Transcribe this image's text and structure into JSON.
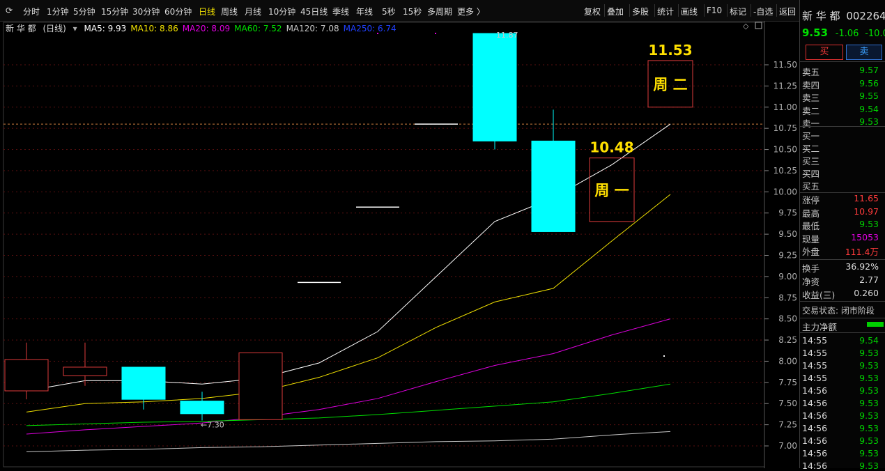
{
  "toolbar": {
    "periods": [
      "分时",
      "1分钟",
      "5分钟",
      "15分钟",
      "30分钟",
      "60分钟",
      "日线",
      "周线",
      "月线",
      "10分钟",
      "45日线",
      "季线",
      "年线",
      "5秒",
      "15秒",
      "多周期",
      "更多 〉"
    ],
    "active_period": "日线",
    "right_buttons": [
      "复权",
      "叠加",
      "多股",
      "统计",
      "画线",
      "F10",
      "标记",
      "-自选",
      "返回"
    ]
  },
  "legend": {
    "name": "新 华 都",
    "period": "(日线)",
    "ma": [
      {
        "label": "MA5: 9.93",
        "color": "#ffffff"
      },
      {
        "label": "MA10: 8.86",
        "color": "#f0e000"
      },
      {
        "label": "MA20: 8.09",
        "color": "#e000e0"
      },
      {
        "label": "MA60: 7.52",
        "color": "#00e000"
      },
      {
        "label": "MA120: 7.08",
        "color": "#c8c8c8"
      },
      {
        "label": "MA250: 6.74",
        "color": "#2040ff"
      }
    ]
  },
  "chart_data": {
    "type": "candlestick",
    "ylim": [
      6.9,
      11.8
    ],
    "y_ticks": [
      "11.50",
      "11.25",
      "11.00",
      "10.75",
      "10.50",
      "10.25",
      "10.00",
      "9.75",
      "9.50",
      "9.25",
      "9.00",
      "8.75",
      "8.50",
      "8.25",
      "8.00",
      "7.75",
      "7.50",
      "7.25",
      "7.00"
    ],
    "reference_price": 10.8,
    "candles": [
      {
        "open": 7.65,
        "close": 8.02,
        "high": 8.22,
        "low": 7.55,
        "color": "red",
        "hollow": true
      },
      {
        "open": 7.93,
        "close": 7.83,
        "high": 8.22,
        "low": 7.71,
        "color": "red",
        "hollow": true
      },
      {
        "open": 7.93,
        "close": 7.55,
        "high": 7.93,
        "low": 7.43,
        "color": "cyan",
        "hollow": false
      },
      {
        "open": 7.53,
        "close": 7.38,
        "high": 7.64,
        "low": 7.3,
        "color": "cyan",
        "hollow": false
      },
      {
        "open": 7.31,
        "close": 8.1,
        "high": 8.1,
        "low": 7.31,
        "color": "red",
        "hollow": true
      },
      {
        "open": 8.93,
        "close": 8.93,
        "high": 8.93,
        "low": 8.93,
        "color": "white",
        "hollow": false
      },
      {
        "open": 9.82,
        "close": 9.82,
        "high": 9.82,
        "low": 9.82,
        "color": "white",
        "hollow": false
      },
      {
        "open": 10.8,
        "close": 10.8,
        "high": 10.8,
        "low": 10.8,
        "color": "white",
        "hollow": false
      },
      {
        "open": 11.87,
        "close": 10.6,
        "high": 11.87,
        "low": 10.5,
        "color": "cyan",
        "hollow": false
      },
      {
        "open": 10.6,
        "close": 9.53,
        "high": 10.97,
        "low": 9.53,
        "color": "cyan",
        "hollow": false
      }
    ],
    "forecast_boxes": [
      {
        "label": "周 一",
        "price_label": "10.48",
        "high": 10.4,
        "low": 9.65
      },
      {
        "label": "周 二",
        "price_label": "11.53",
        "high": 11.55,
        "low": 11.0
      }
    ],
    "annotations": [
      {
        "text": "←7.30",
        "x_index": 3,
        "y": 7.3
      },
      {
        "text": "11.87",
        "x_index": 8,
        "y": 11.87
      }
    ],
    "series": [
      {
        "name": "MA5",
        "color": "#ffffff",
        "points": [
          [
            0,
            7.65
          ],
          [
            1,
            7.77
          ],
          [
            2,
            7.77
          ],
          [
            3,
            7.73
          ],
          [
            4,
            7.8
          ],
          [
            5,
            7.98
          ],
          [
            6,
            8.35
          ],
          [
            7,
            9.0
          ],
          [
            8,
            9.65
          ],
          [
            9,
            9.93
          ],
          [
            10,
            10.32
          ],
          [
            11,
            10.8
          ]
        ]
      },
      {
        "name": "MA10",
        "color": "#f0e000",
        "points": [
          [
            0,
            7.4
          ],
          [
            1,
            7.5
          ],
          [
            2,
            7.52
          ],
          [
            3,
            7.56
          ],
          [
            4,
            7.64
          ],
          [
            5,
            7.81
          ],
          [
            6,
            8.04
          ],
          [
            7,
            8.4
          ],
          [
            8,
            8.7
          ],
          [
            9,
            8.86
          ],
          [
            10,
            9.42
          ],
          [
            11,
            9.97
          ]
        ]
      },
      {
        "name": "MA20",
        "color": "#e000e0",
        "points": [
          [
            0,
            7.14
          ],
          [
            1,
            7.19
          ],
          [
            2,
            7.23
          ],
          [
            3,
            7.27
          ],
          [
            4,
            7.34
          ],
          [
            5,
            7.43
          ],
          [
            6,
            7.56
          ],
          [
            7,
            7.76
          ],
          [
            8,
            7.95
          ],
          [
            9,
            8.09
          ],
          [
            10,
            8.31
          ],
          [
            11,
            8.5
          ]
        ]
      },
      {
        "name": "MA60",
        "color": "#00e000",
        "points": [
          [
            0,
            7.24
          ],
          [
            1,
            7.26
          ],
          [
            2,
            7.28
          ],
          [
            3,
            7.29
          ],
          [
            4,
            7.31
          ],
          [
            5,
            7.33
          ],
          [
            6,
            7.37
          ],
          [
            7,
            7.42
          ],
          [
            8,
            7.47
          ],
          [
            9,
            7.52
          ],
          [
            10,
            7.62
          ],
          [
            11,
            7.73
          ]
        ]
      },
      {
        "name": "MA120",
        "color": "#c8c8c8",
        "points": [
          [
            0,
            6.93
          ],
          [
            1,
            6.95
          ],
          [
            2,
            6.96
          ],
          [
            3,
            6.98
          ],
          [
            4,
            6.99
          ],
          [
            5,
            7.01
          ],
          [
            6,
            7.03
          ],
          [
            7,
            7.05
          ],
          [
            8,
            7.06
          ],
          [
            9,
            7.08
          ],
          [
            10,
            7.13
          ],
          [
            11,
            7.17
          ]
        ]
      }
    ]
  },
  "quote": {
    "name": "新 华 都",
    "code": "002264",
    "price": "9.53",
    "change": "-1.06",
    "change_pct": "-10.0",
    "buy_label": "买",
    "sell_label": "卖",
    "asks": [
      {
        "label": "卖五",
        "price": "9.57"
      },
      {
        "label": "卖四",
        "price": "9.56"
      },
      {
        "label": "卖三",
        "price": "9.55"
      },
      {
        "label": "卖二",
        "price": "9.54"
      },
      {
        "label": "卖一",
        "price": "9.53"
      }
    ],
    "bids": [
      "买一",
      "买二",
      "买三",
      "买四",
      "买五"
    ],
    "stats": [
      {
        "label": "涨停",
        "value": "11.65",
        "color": "#ff3b3b"
      },
      {
        "label": "最高",
        "value": "10.97",
        "color": "#ff3b3b"
      },
      {
        "label": "最低",
        "value": "9.53",
        "color": "#00d000"
      },
      {
        "label": "现量",
        "value": "15053",
        "color": "#e000e0"
      },
      {
        "label": "外盘",
        "value": "111.4万",
        "color": "#ff3b3b"
      }
    ],
    "stats2": [
      {
        "label": "换手",
        "value": "36.92%"
      },
      {
        "label": "净资",
        "value": "2.77"
      },
      {
        "label": "收益(三)",
        "value": "0.260"
      }
    ],
    "trade_status": "交易状态: 闭市阶段",
    "main_flow": "主力净额",
    "ticks": [
      {
        "time": "14:55",
        "price": "9.54"
      },
      {
        "time": "14:55",
        "price": "9.53"
      },
      {
        "time": "14:55",
        "price": "9.53"
      },
      {
        "time": "14:55",
        "price": "9.53"
      },
      {
        "time": "14:56",
        "price": "9.53"
      },
      {
        "time": "14:56",
        "price": "9.53"
      },
      {
        "time": "14:56",
        "price": "9.53"
      },
      {
        "time": "14:56",
        "price": "9.53"
      },
      {
        "time": "14:56",
        "price": "9.53"
      },
      {
        "time": "14:56",
        "price": "9.53"
      },
      {
        "time": "14:56",
        "price": "9.53"
      }
    ]
  }
}
